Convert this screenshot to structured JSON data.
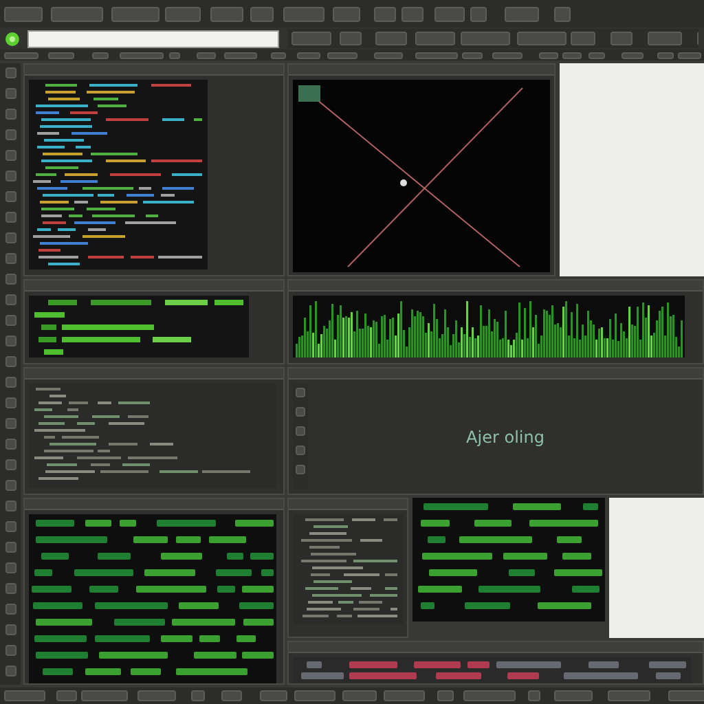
{
  "viewer": {
    "label": "Ajer oling"
  }
}
